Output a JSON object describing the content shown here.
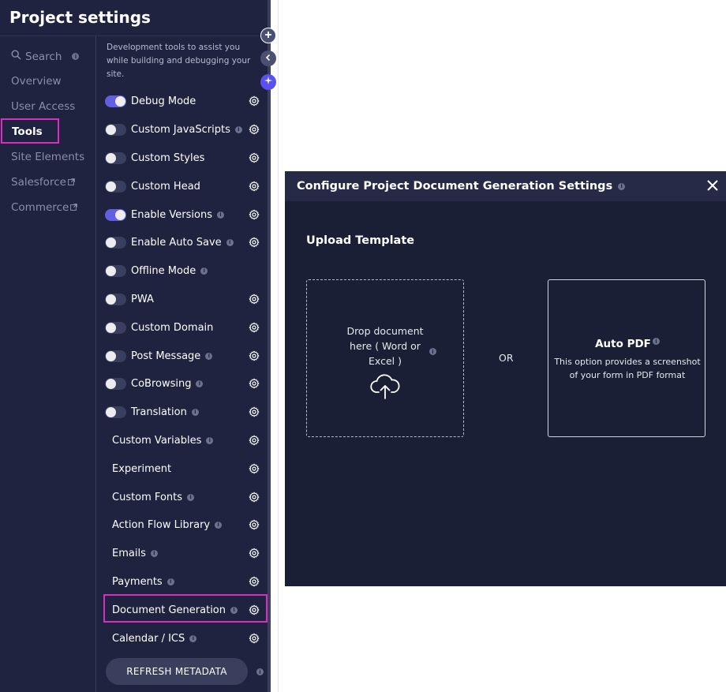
{
  "panel": {
    "title": "Project settings",
    "tools_description": "Development tools to assist you while building and debugging your site."
  },
  "nav": {
    "items": [
      {
        "label": "Search",
        "icon": "search-icon",
        "info": true
      },
      {
        "label": "Overview"
      },
      {
        "label": "User Access"
      },
      {
        "label": "Tools",
        "active": true
      },
      {
        "label": "Site Elements"
      },
      {
        "label": "Salesforce",
        "icon": "external-link-icon"
      },
      {
        "label": "Commerce",
        "icon": "external-link-icon"
      }
    ]
  },
  "tools": [
    {
      "label": "Debug Mode",
      "toggle": true,
      "on": true,
      "info": false,
      "gear": true
    },
    {
      "label": "Custom JavaScripts",
      "toggle": true,
      "on": false,
      "info": true,
      "gear": true
    },
    {
      "label": "Custom Styles",
      "toggle": true,
      "on": false,
      "info": false,
      "gear": true
    },
    {
      "label": "Custom Head",
      "toggle": true,
      "on": false,
      "info": false,
      "gear": true
    },
    {
      "label": "Enable Versions",
      "toggle": true,
      "on": true,
      "info": true,
      "gear": true
    },
    {
      "label": "Enable Auto Save",
      "toggle": true,
      "on": false,
      "info": true,
      "gear": true
    },
    {
      "label": "Offline Mode",
      "toggle": true,
      "on": false,
      "info": true,
      "gear": false
    },
    {
      "label": "PWA",
      "toggle": true,
      "on": false,
      "info": false,
      "gear": true
    },
    {
      "label": "Custom Domain",
      "toggle": true,
      "on": false,
      "info": false,
      "gear": true
    },
    {
      "label": "Post Message",
      "toggle": true,
      "on": false,
      "info": true,
      "gear": true
    },
    {
      "label": "CoBrowsing",
      "toggle": true,
      "on": false,
      "info": true,
      "gear": true
    },
    {
      "label": "Translation",
      "toggle": true,
      "on": false,
      "info": true,
      "gear": true
    },
    {
      "label": "Custom Variables",
      "toggle": false,
      "info": true,
      "gear": true
    },
    {
      "label": "Experiment",
      "toggle": false,
      "info": false,
      "gear": true
    },
    {
      "label": "Custom Fonts",
      "toggle": false,
      "info": true,
      "gear": true
    },
    {
      "label": "Action Flow Library",
      "toggle": false,
      "info": true,
      "gear": true
    },
    {
      "label": "Emails",
      "toggle": false,
      "info": true,
      "gear": true
    },
    {
      "label": "Payments",
      "toggle": false,
      "info": true,
      "gear": true
    },
    {
      "label": "Document Generation",
      "toggle": false,
      "info": true,
      "gear": true
    },
    {
      "label": "Calendar / ICS",
      "toggle": false,
      "info": true,
      "gear": true
    }
  ],
  "refresh_button": "REFRESH METADATA",
  "modal": {
    "title": "Configure Project Document Generation Settings",
    "upload_title": "Upload Template",
    "drop_text": "Drop document here ( Word or Excel )",
    "or_text": "OR",
    "auto_pdf_title": "Auto PDF",
    "auto_pdf_desc": "This option provides a screenshot of your form in PDF format"
  },
  "colors": {
    "panel_bg": "#1f2340",
    "modal_bg": "#1b1f35",
    "toggle_on": "#6b63f0",
    "highlight": "#d62fbd"
  },
  "info_glyph": "i"
}
